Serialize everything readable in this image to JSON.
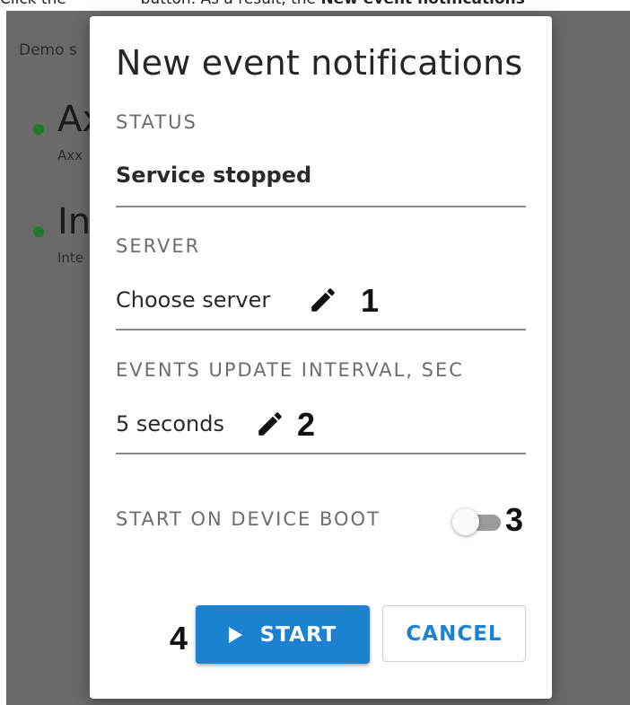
{
  "caption": {
    "pre": "Click the",
    "mid": "button. As a result, the",
    "bold": "New event notifications"
  },
  "background": {
    "demo_label": "Demo s",
    "item1_title": "Ax",
    "item1_sub": "Axx",
    "item2_title": "In",
    "item2_sub": "Inte",
    "status_dot_color": "#1f7a2a"
  },
  "dialog": {
    "title": "New event notifications",
    "status": {
      "label": "STATUS",
      "value": "Service stopped"
    },
    "server": {
      "label": "SERVER",
      "value": "Choose server",
      "edit_icon": "pencil-icon",
      "marker": "1"
    },
    "interval": {
      "label": "EVENTS UPDATE INTERVAL, SEC",
      "value": "5 seconds",
      "edit_icon": "pencil-icon",
      "marker": "2"
    },
    "boot": {
      "label": "START ON DEVICE BOOT",
      "enabled": false,
      "marker": "3"
    },
    "actions": {
      "marker": "4",
      "start_label": "START",
      "start_icon": "play-icon",
      "cancel_label": "CANCEL"
    }
  },
  "colors": {
    "accent": "#1b82d1",
    "backdrop": "#6a6a6a"
  }
}
